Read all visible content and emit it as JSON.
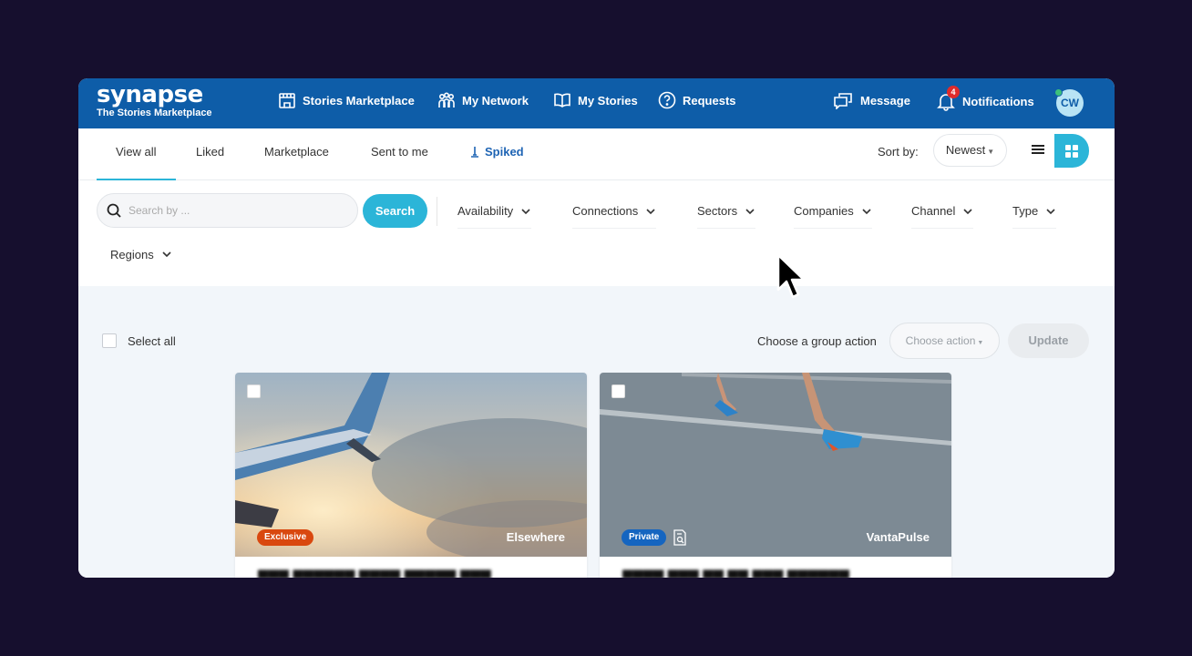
{
  "brand": {
    "name": "synapse",
    "tagline": "The Stories Marketplace"
  },
  "nav": {
    "stories_marketplace": "Stories Marketplace",
    "my_network": "My Network",
    "my_stories": "My Stories",
    "requests": "Requests",
    "message": "Message",
    "notifications": "Notifications",
    "notification_count": "4",
    "avatar_initials": "CW"
  },
  "tabs": {
    "view_all": "View all",
    "liked": "Liked",
    "marketplace": "Marketplace",
    "sent_to_me": "Sent to me",
    "spiked": "Spiked"
  },
  "sort": {
    "label": "Sort by:",
    "value": "Newest"
  },
  "search": {
    "placeholder": "Search by ...",
    "button": "Search"
  },
  "filters": {
    "availability": "Availability",
    "connections": "Connections",
    "sectors": "Sectors",
    "companies": "Companies",
    "channel": "Channel",
    "type": "Type",
    "regions": "Regions"
  },
  "bulk": {
    "select_all": "Select all",
    "group_action_label": "Choose a group action",
    "choose_action": "Choose action",
    "update": "Update"
  },
  "cards": [
    {
      "badge": "Exclusive",
      "badge_color": "#d9480f",
      "source": "Elsewhere"
    },
    {
      "badge": "Private",
      "badge_color": "#1565c0",
      "source": "VantaPulse"
    }
  ],
  "colors": {
    "primary": "#0e5da8",
    "accent": "#2bb5d8"
  }
}
